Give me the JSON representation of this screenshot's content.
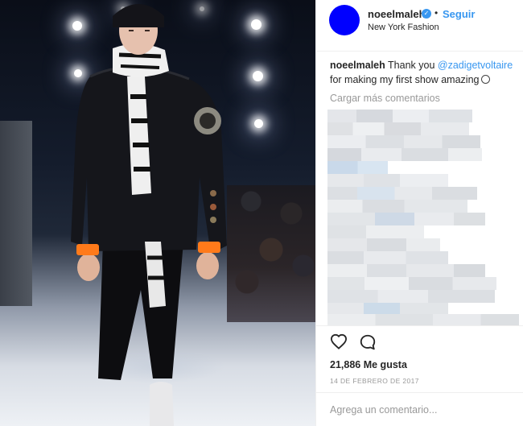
{
  "post": {
    "username": "noeelmaleh",
    "verified_icon": "verified-badge-icon",
    "follow_label": "Seguir",
    "separator": "•",
    "location": "New York Fashion",
    "avatar_color": "#0000ff"
  },
  "caption": {
    "username": "noeelmaleh",
    "text_before": "Thank you ",
    "mention": "@zadigetvoltaire",
    "text_after": "for making my first show amazing",
    "emoji_icon": "grinning-face-icon"
  },
  "comments": {
    "load_more_label": "Cargar más comentarios",
    "blurred": true
  },
  "actions": {
    "like_icon": "heart-icon",
    "comment_icon": "comment-bubble-icon",
    "likes_count": "21,886",
    "likes_label": "Me gusta",
    "date": "14 DE FEBRERO DE 2017"
  },
  "add_comment": {
    "placeholder": "Agrega un comentario..."
  },
  "colors": {
    "accent": "#3897f0",
    "text": "#262626",
    "muted": "#999999",
    "divider": "#efefef"
  }
}
